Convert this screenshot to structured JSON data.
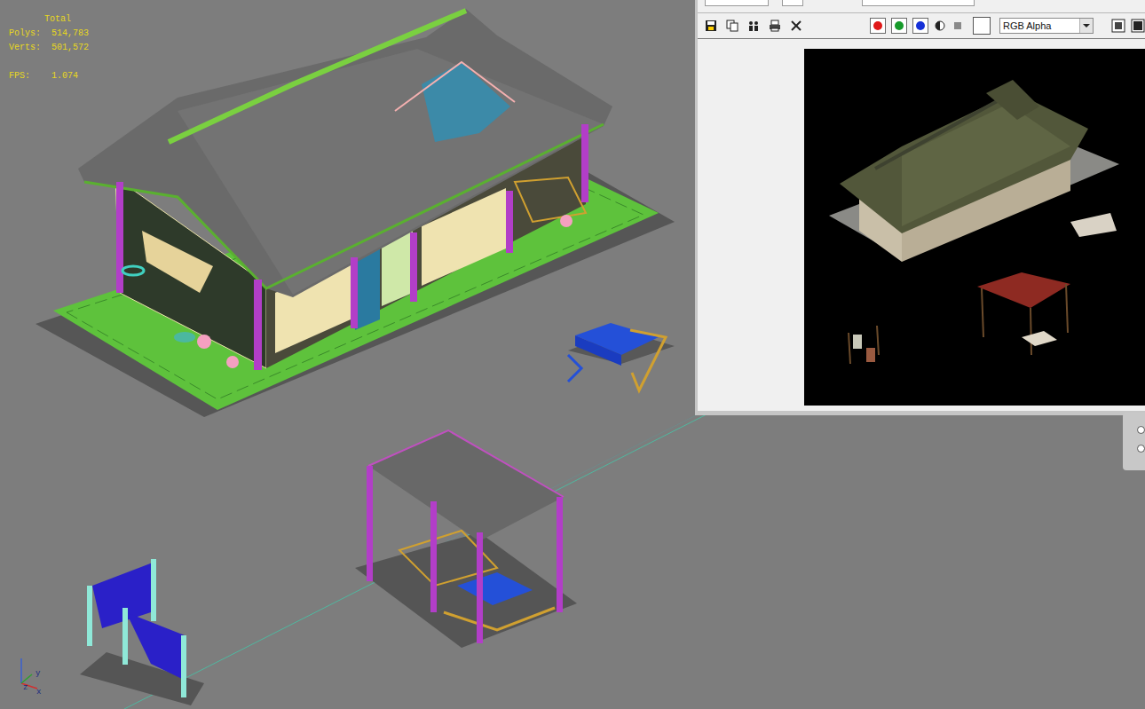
{
  "viewport": {
    "stats": {
      "title": "Total",
      "counts": [
        {
          "label": "Polys:",
          "value": "514,783"
        },
        {
          "label": "Verts:",
          "value": "501,572"
        }
      ],
      "fps": {
        "label": "FPS:",
        "value": "1.074"
      }
    },
    "axes": [
      {
        "label": "y"
      },
      {
        "label": "x"
      },
      {
        "label": "z"
      }
    ]
  },
  "render_window": {
    "channels": [
      {
        "name": "red",
        "on": true,
        "color": "#e01818"
      },
      {
        "name": "green",
        "on": true,
        "color": "#169a2a"
      },
      {
        "name": "blue",
        "on": true,
        "color": "#1530d8"
      }
    ],
    "color_swatch": "#ffffff",
    "channel_display": {
      "value": "RGB Alpha"
    }
  },
  "side_panel": {
    "radios": [
      {
        "selected": false
      },
      {
        "selected": false
      }
    ]
  }
}
